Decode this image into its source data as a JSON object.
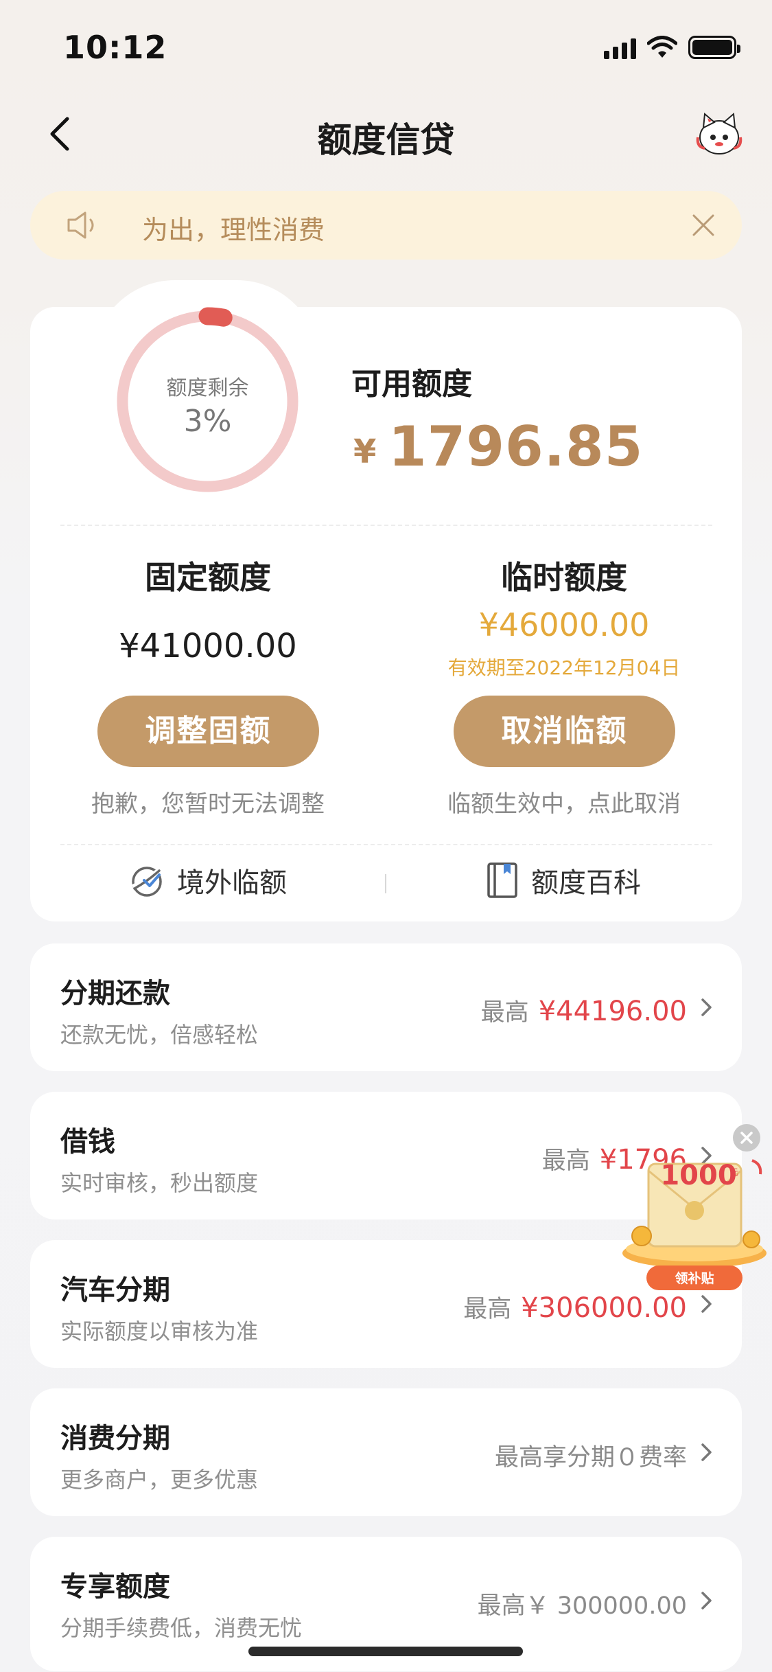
{
  "status_bar": {
    "time": "10:12"
  },
  "nav": {
    "title": "额度信贷",
    "back_icon": "chevron-left-icon",
    "mascot_icon": "cat-mascot-icon"
  },
  "notice": {
    "text": "为出，理性消费",
    "icon": "speaker-icon",
    "close_icon": "close-icon"
  },
  "credit": {
    "ring_label": "额度剩余",
    "ring_percent_text": "3%",
    "ring_fraction": 0.03,
    "available_label": "可用额度",
    "available_currency": "¥",
    "available_amount": "1796.85",
    "fixed": {
      "title": "固定额度",
      "amount": "¥41000.00",
      "button": "调整固额",
      "hint": "抱歉，您暂时无法调整"
    },
    "temporary": {
      "title": "临时额度",
      "amount": "¥46000.00",
      "expire": "有效期至2022年12月04日",
      "button": "取消临额",
      "hint": "临额生效中，点此取消"
    },
    "links": [
      {
        "label": "境外临额",
        "icon": "globe-plane-icon"
      },
      {
        "label": "额度百科",
        "icon": "book-icon"
      }
    ]
  },
  "services": [
    {
      "title": "分期还款",
      "subtitle": "还款无忧，倍感轻松",
      "prefix": "最高",
      "amount": "¥44196.00"
    },
    {
      "title": "借钱",
      "subtitle": "实时审核，秒出额度",
      "prefix": "最高",
      "amount": "¥1796"
    },
    {
      "title": "汽车分期",
      "subtitle": "实际额度以审核为准",
      "prefix": "最高",
      "amount": "¥306000.00"
    },
    {
      "title": "消费分期",
      "subtitle": "更多商户，更多优惠",
      "prefix": "最高享分期０费率",
      "amount": ""
    },
    {
      "title": "专享额度",
      "subtitle": "分期手续费低，消费无忧",
      "prefix": "最高￥ 300000.00",
      "amount": ""
    }
  ],
  "promo": {
    "amount": "1000",
    "unit": "元",
    "button": "领补贴"
  },
  "colors": {
    "accent": "#c49a69",
    "gold_text": "#b8895a",
    "temp_yellow": "#e4a93b",
    "red": "#e2454a",
    "ring_track": "#f3caca",
    "ring_fill": "#e15c55"
  }
}
